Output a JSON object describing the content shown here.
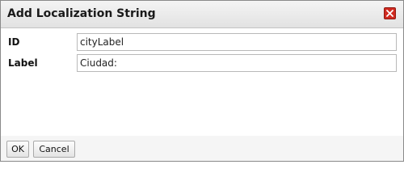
{
  "dialog": {
    "title": "Add Localization String",
    "close_icon": "close-icon"
  },
  "form": {
    "fields": [
      {
        "label": "ID",
        "value": "cityLabel"
      },
      {
        "label": "Label",
        "value": "Ciudad:"
      }
    ]
  },
  "buttons": {
    "ok_label": "OK",
    "cancel_label": "Cancel"
  },
  "colors": {
    "close_button": "#d02a20"
  }
}
